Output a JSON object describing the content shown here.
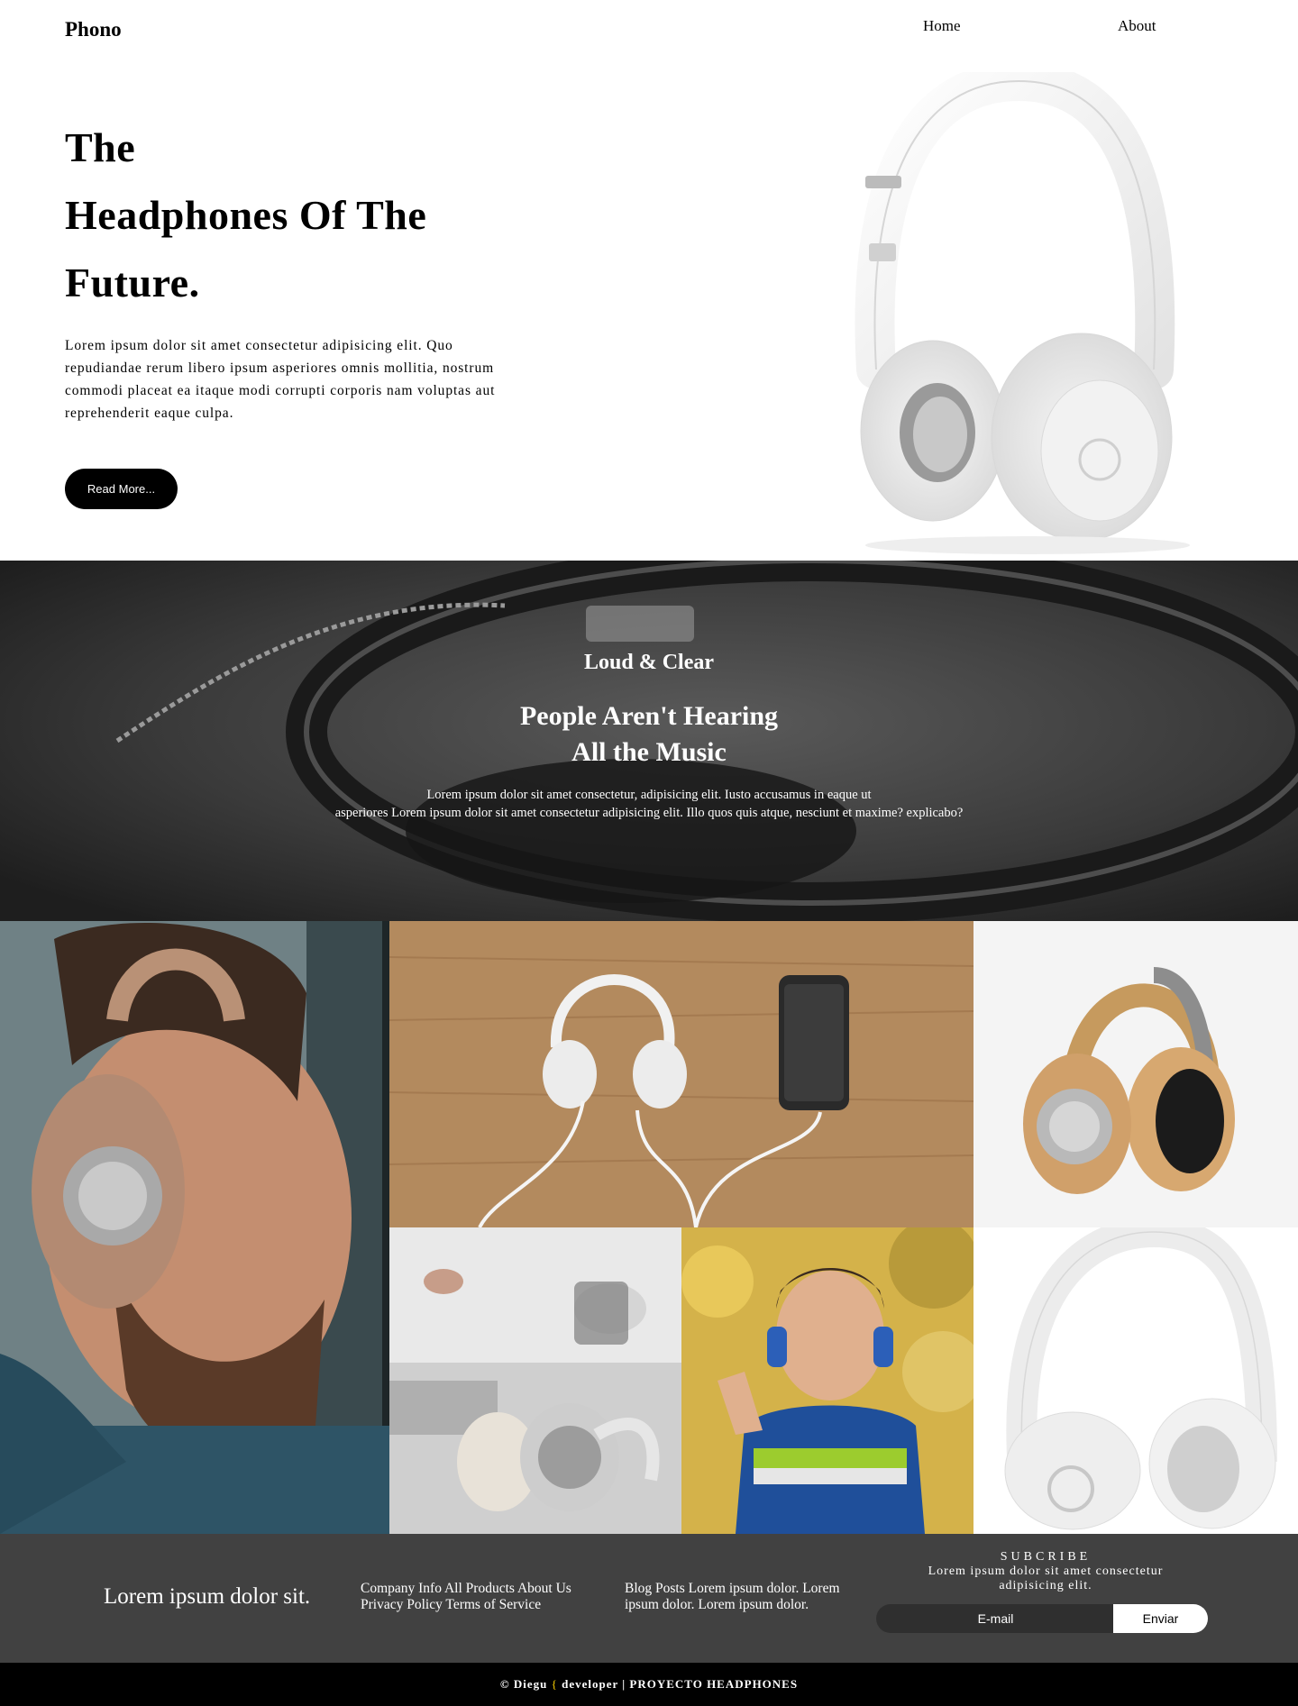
{
  "nav": {
    "brand": "Phono",
    "links": [
      "Home",
      "About"
    ]
  },
  "hero": {
    "title_lines": [
      "The",
      "Headphones Of The",
      "Future."
    ],
    "text": "Lorem ipsum dolor sit amet consectetur adipisicing elit. Quo repudiandae rerum libero ipsum asperiores omnis mollitia, nostrum commodi placeat ea itaque modi corrupti corporis nam voluptas aut reprehenderit eaque culpa.",
    "button": "Read More..."
  },
  "banner": {
    "subtitle": "Loud & Clear",
    "title_lines": [
      "People Aren't Hearing",
      "All the Music"
    ],
    "text_line1": "Lorem ipsum dolor sit amet consectetur, adipisicing elit. Iusto accusamus in eaque ut",
    "text_line2": "asperiores Lorem ipsum dolor sit amet consectetur adipisicing elit. Illo quos quis atque, nesciunt et maxime? explicabo?"
  },
  "footer": {
    "tagline": "Lorem ipsum dolor sit.",
    "col1": "Company Info All Products About Us Privacy Policy Terms of Service",
    "col2": "Blog Posts Lorem ipsum dolor. Lorem ipsum dolor. Lorem ipsum dolor.",
    "subscribe_title": "SUBCRIBE",
    "subscribe_text": "Lorem ipsum dolor sit amet consectetur adipisicing elit.",
    "email_placeholder": "E-mail",
    "send_label": "Enviar"
  },
  "bottom_bar": {
    "left": "© Diegu",
    "brace": "{",
    "right": "developer | PROYECTO HEADPHONES"
  }
}
